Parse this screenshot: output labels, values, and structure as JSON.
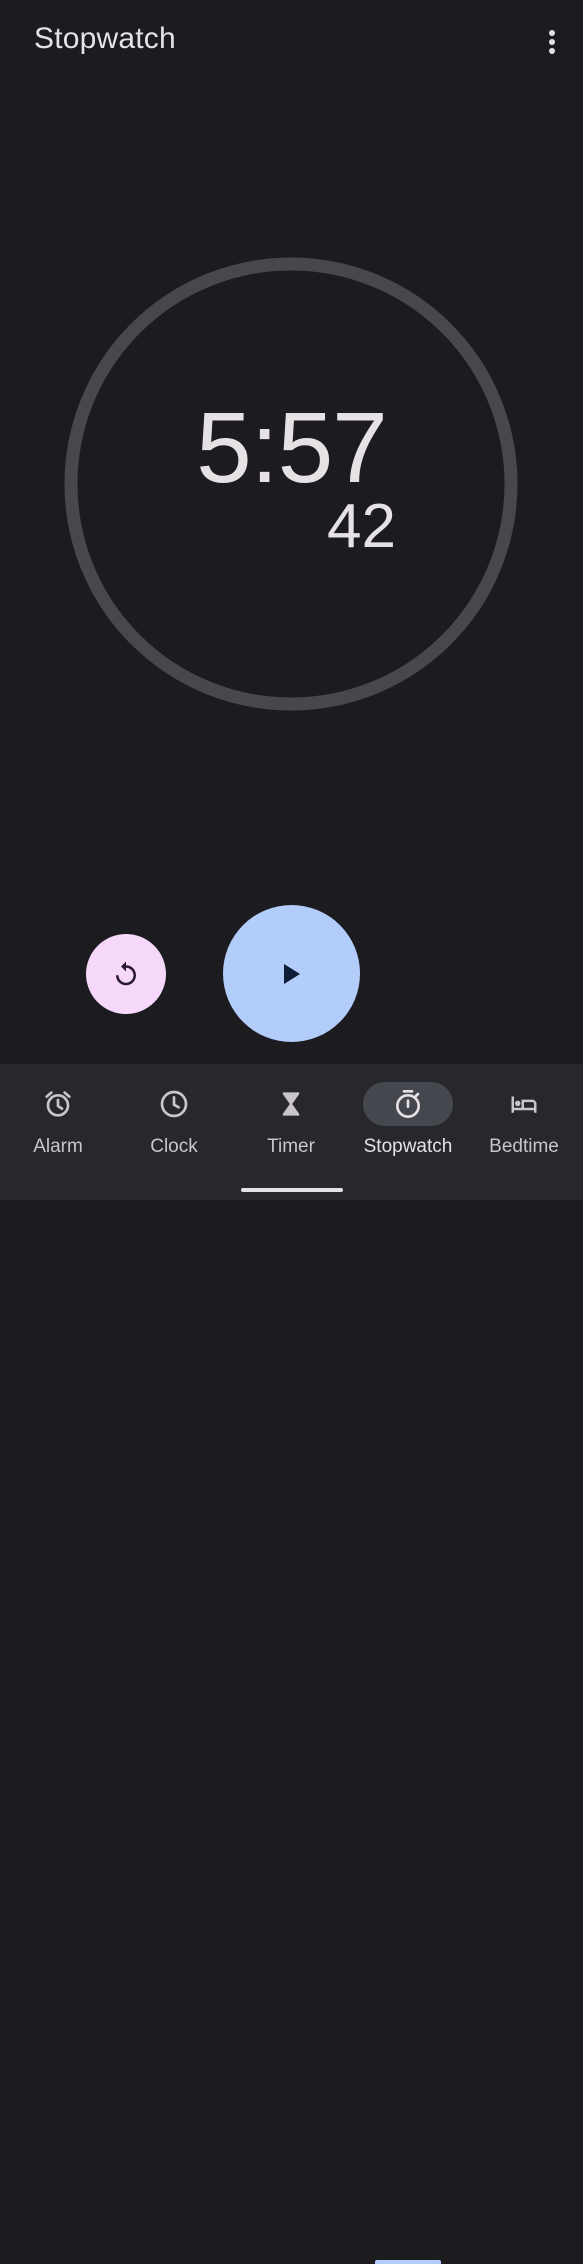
{
  "app": {
    "title": "Stopwatch"
  },
  "toolbar": {
    "more_icon": "more-vert-icon"
  },
  "stopwatch": {
    "elapsed": "5:57",
    "hundredths": "42",
    "state": "paused"
  },
  "controls": {
    "reset_icon": "reset-icon",
    "play_icon": "play-icon",
    "reset_color": "#f6d8fb",
    "play_color": "#b3cdfb"
  },
  "nav": {
    "items": [
      {
        "label": "Alarm",
        "icon": "alarm-icon"
      },
      {
        "label": "Clock",
        "icon": "clock-icon"
      },
      {
        "label": "Timer",
        "icon": "hourglass-icon"
      },
      {
        "label": "Stopwatch",
        "icon": "stopwatch-icon",
        "active": true
      },
      {
        "label": "Bedtime",
        "icon": "bed-icon"
      }
    ]
  },
  "colors": {
    "background": "#1c1b1f",
    "dial_ring": "#46484e",
    "nav_background": "#28282c",
    "active_pill": "#44474e"
  }
}
